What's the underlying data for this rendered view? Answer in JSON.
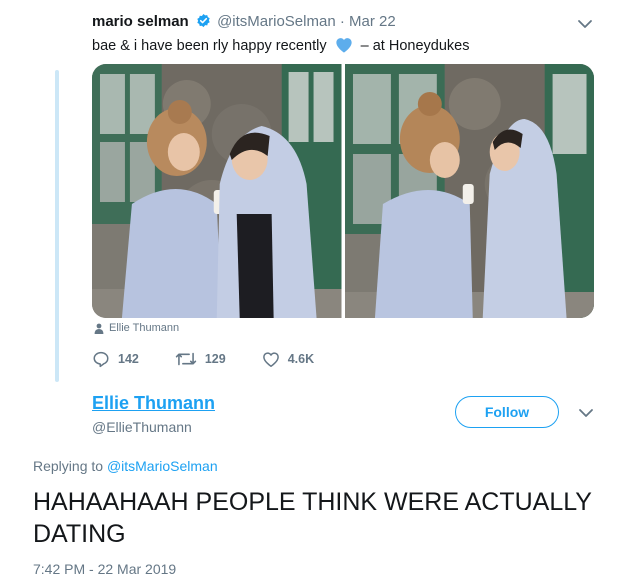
{
  "quoted_tweet": {
    "display_name": "mario selman",
    "handle": "@itsMarioSelman",
    "separator": "·",
    "date": "Mar 22",
    "text_before_emoji": "bae & i have been rly happy recently",
    "text_after_emoji": "– at Honeydukes",
    "emoji": "blue-heart",
    "photo_tag": "Ellie Thumann",
    "stats": {
      "replies": "142",
      "retweets": "129",
      "likes": "4.6K"
    },
    "icons": [
      "verified-badge-icon",
      "chevron-down-icon",
      "person-icon",
      "reply-icon",
      "retweet-icon",
      "like-icon"
    ]
  },
  "main_tweet": {
    "display_name": "Ellie Thumann",
    "handle": "@EllieThumann",
    "follow_label": "Follow",
    "replying_prefix": "Replying to",
    "replying_to": "@itsMarioSelman",
    "text": "HAHAAHAAH PEOPLE THINK WERE ACTUALLY DATING",
    "timestamp": "7:42 PM - 22 Mar 2019"
  },
  "colors": {
    "accent": "#1da1f2",
    "secondary_text": "#657786",
    "primary_text": "#14171a",
    "thread_line": "#cce7f7"
  }
}
